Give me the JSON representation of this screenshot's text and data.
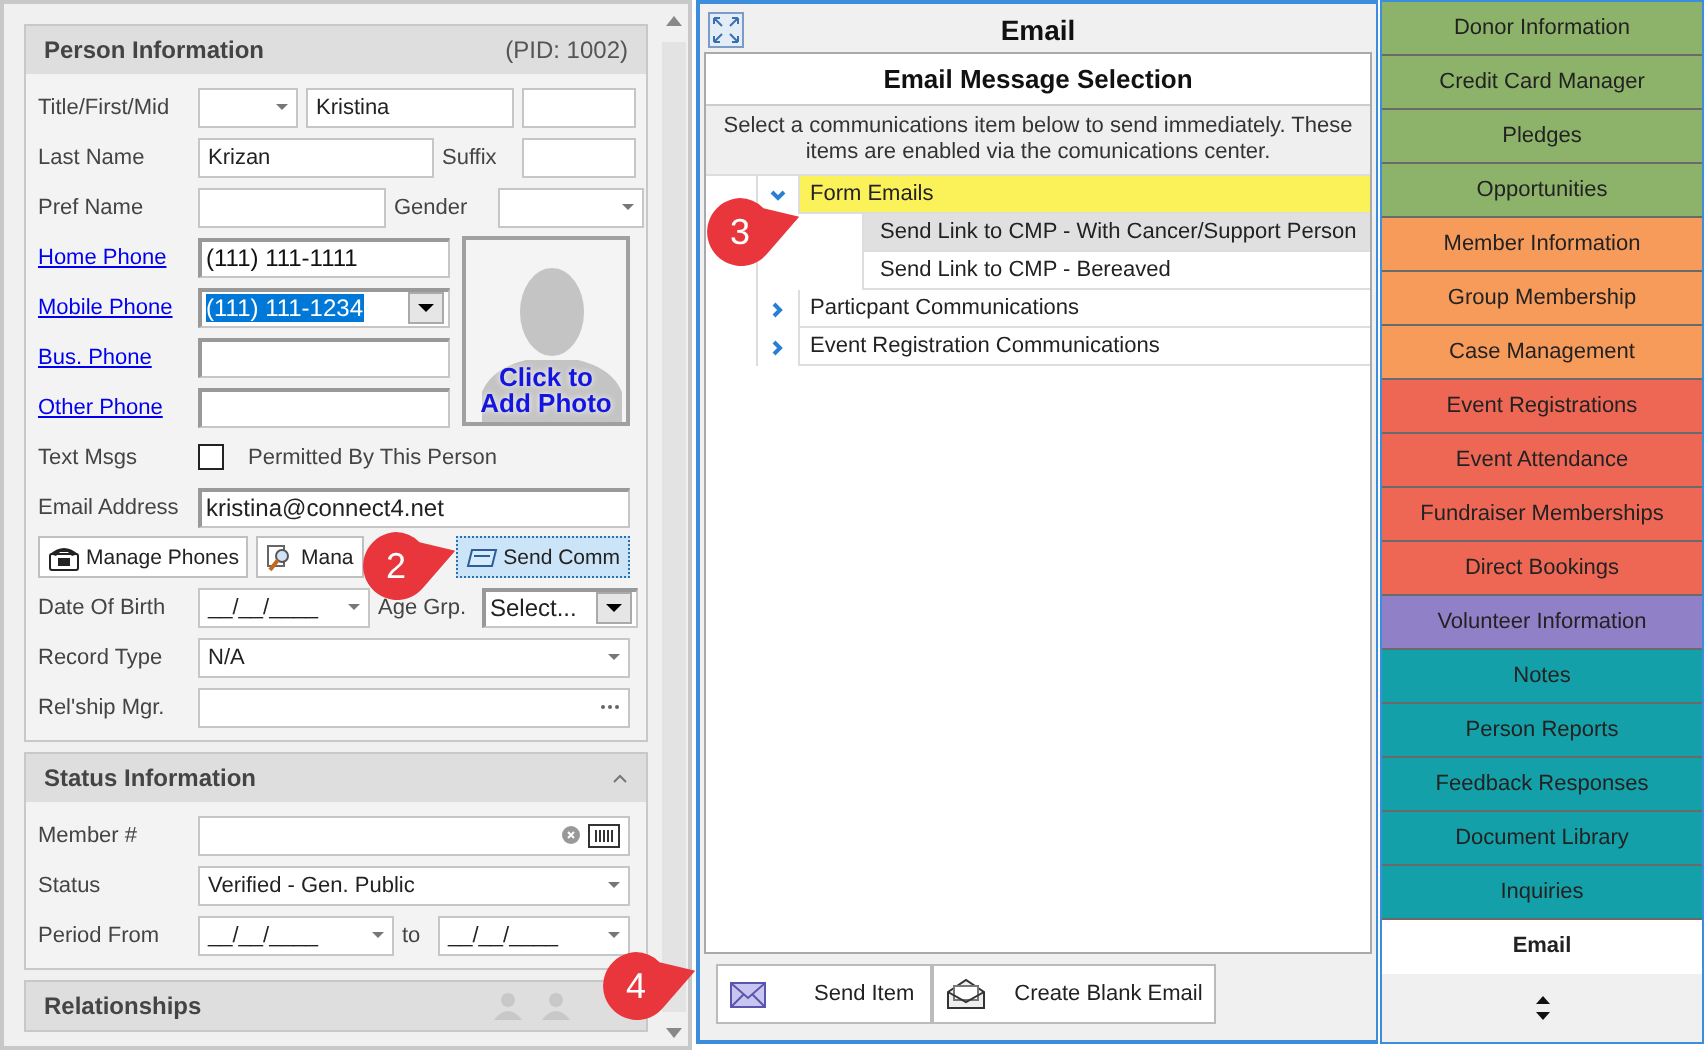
{
  "person": {
    "heading": "Person Information",
    "pid": "(PID: 1002)",
    "title_first_mid": {
      "label": "Title/First/Mid",
      "first": "Kristina"
    },
    "last_name": {
      "label": "Last Name",
      "value": "Krizan",
      "suffix_label": "Suffix"
    },
    "pref_name": {
      "label": "Pref Name",
      "gender_label": "Gender"
    },
    "phones": [
      {
        "label": "Home Phone",
        "value": "(111) 111-1111",
        "kind": "text"
      },
      {
        "label": "Mobile Phone",
        "value": "(111) 111-1234",
        "kind": "dropdown",
        "text_selected": true
      },
      {
        "label": "Bus. Phone",
        "kind": "text"
      },
      {
        "label": "Other Phone",
        "kind": "text"
      }
    ],
    "photo_caption": "Click to Add Photo",
    "text_msgs": {
      "label": "Text Msgs",
      "checkbox_label": "Permitted By This Person",
      "checked": false
    },
    "email": {
      "label": "Email Address",
      "value": "kristina@connect4.net"
    },
    "buttons": [
      {
        "label": "Manage Phones",
        "focused": false
      },
      {
        "label": "Mana",
        "focused": false
      },
      {
        "label": "Send Comm",
        "focused": true
      }
    ],
    "dob": {
      "label": "Date Of Birth",
      "value": "__/__/____",
      "age_label": "Age Grp.",
      "age_value": "Select..."
    },
    "record_type": {
      "label": "Record Type",
      "value": "N/A"
    },
    "relship": {
      "label": "Rel'ship Mgr."
    }
  },
  "status": {
    "heading": "Status Information",
    "member_label": "Member #",
    "status_label": "Status",
    "status_value": "Verified - Gen. Public",
    "period_label": "Period From",
    "from": "__/__/____",
    "to_label": "to",
    "to": "__/__/____"
  },
  "relationships": {
    "heading": "Relationships"
  },
  "email_panel": {
    "title": "Email",
    "subtitle": "Email Message Selection",
    "instructions": "Select a communications item below to send immediately. These items are enabled via the comunications center.",
    "tree": [
      {
        "label": "Form Emails",
        "expanded": true,
        "highlighted": true,
        "children": [
          {
            "label": "Send Link to CMP - With Cancer/Support Person",
            "selected": true
          },
          {
            "label": "Send Link to CMP - Bereaved",
            "selected": false
          }
        ]
      },
      {
        "label": "Particpant Communications",
        "expanded": false,
        "highlighted": false
      },
      {
        "label": "Event Registration Communications",
        "expanded": false,
        "highlighted": false
      }
    ],
    "buttons": [
      {
        "label": "Send Item"
      },
      {
        "label": "Create Blank Email"
      }
    ]
  },
  "nav": [
    {
      "label": "Donor Information",
      "color": "#8db36a",
      "selected": false
    },
    {
      "label": "Credit Card Manager",
      "color": "#8db36a",
      "selected": false
    },
    {
      "label": "Pledges",
      "color": "#8db36a",
      "selected": false
    },
    {
      "label": "Opportunities",
      "color": "#8db36a",
      "selected": false
    },
    {
      "label": "Member Information",
      "color": "#f79b5b",
      "selected": false
    },
    {
      "label": "Group Membership",
      "color": "#f79b5b",
      "selected": false
    },
    {
      "label": "Case Management",
      "color": "#f79b5b",
      "selected": false
    },
    {
      "label": "Event Registrations",
      "color": "#ee6755",
      "selected": false
    },
    {
      "label": "Event Attendance",
      "color": "#ee6755",
      "selected": false
    },
    {
      "label": "Fundraiser Memberships",
      "color": "#ee6755",
      "selected": false
    },
    {
      "label": "Direct Bookings",
      "color": "#ee6755",
      "selected": false
    },
    {
      "label": "Volunteer Information",
      "color": "#9080c8",
      "selected": false
    },
    {
      "label": "Notes",
      "color": "#13a0a8",
      "selected": false
    },
    {
      "label": "Person Reports",
      "color": "#13a0a8",
      "selected": false
    },
    {
      "label": "Feedback Responses",
      "color": "#13a0a8",
      "selected": false
    },
    {
      "label": "Document Library",
      "color": "#13a0a8",
      "selected": false
    },
    {
      "label": "Inquiries",
      "color": "#13a0a8",
      "selected": false
    },
    {
      "label": "Email",
      "selected": true
    }
  ],
  "callouts": [
    "2",
    "3",
    "4"
  ]
}
